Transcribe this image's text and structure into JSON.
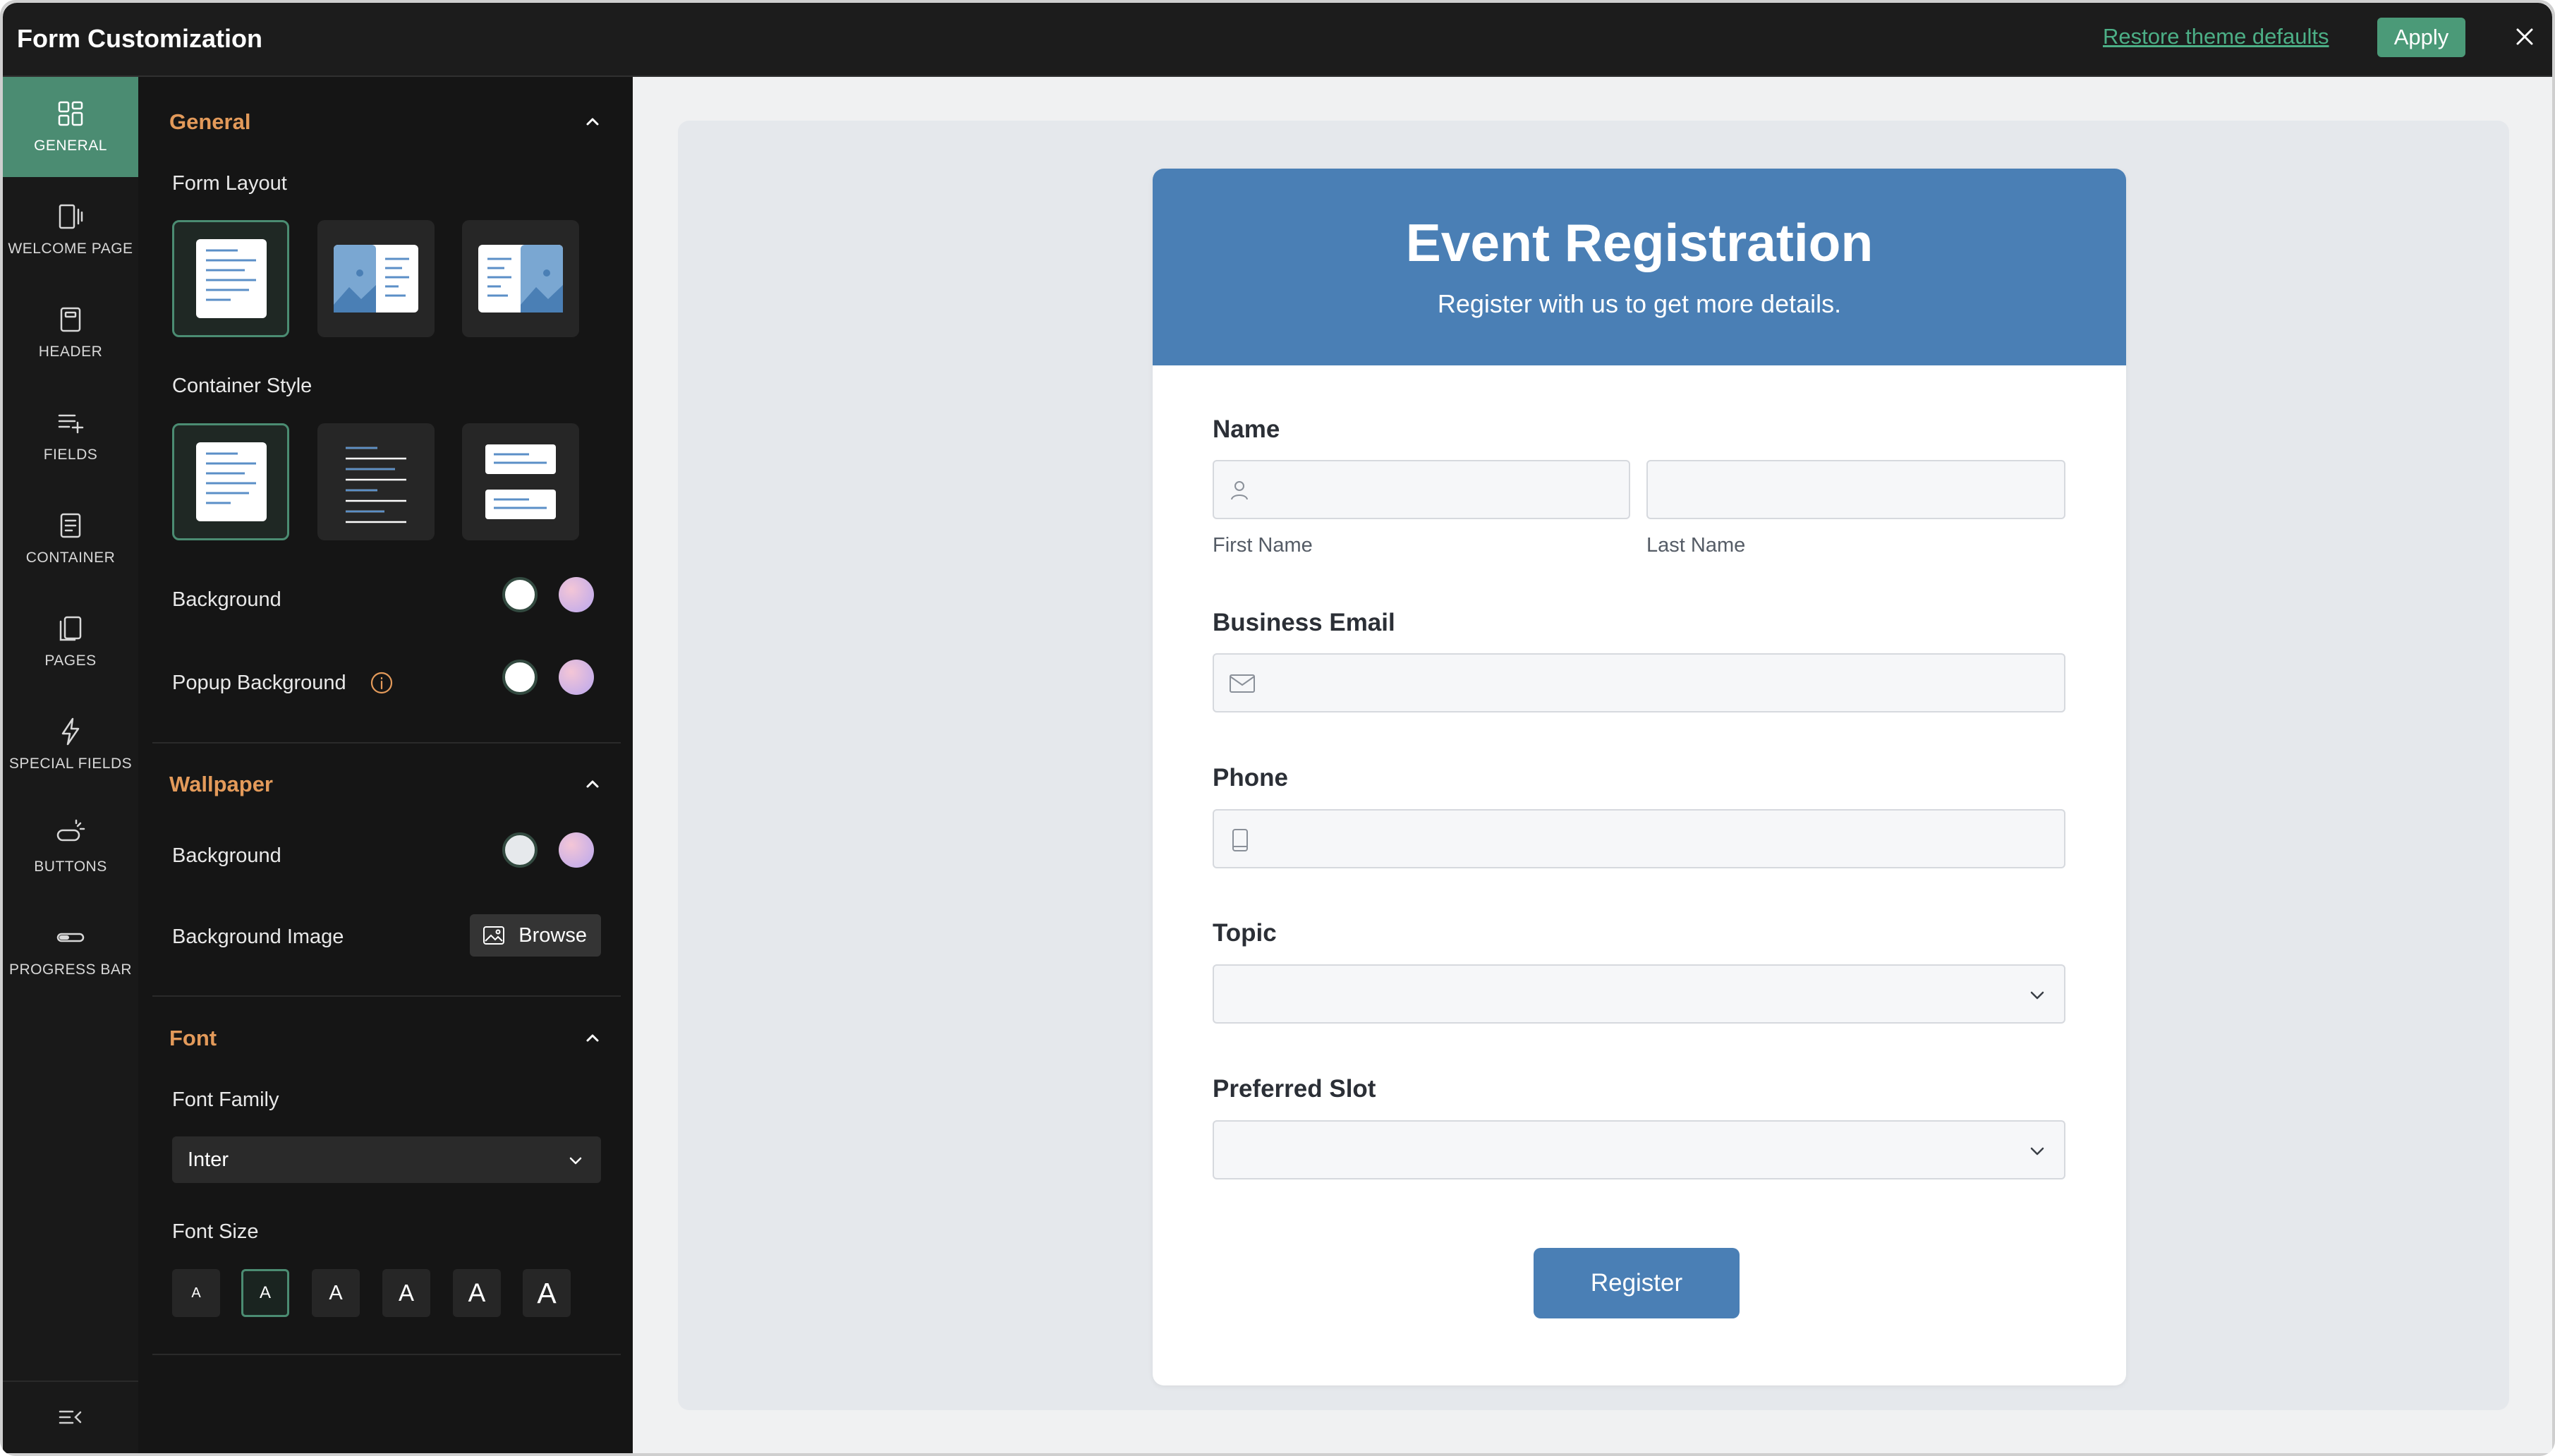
{
  "window": {
    "title": "Form Customization",
    "restore_label": "Restore theme defaults",
    "apply_label": "Apply",
    "close_icon": "close-icon"
  },
  "rail": {
    "items": [
      {
        "label": "GENERAL",
        "icon": "grid-icon",
        "active": true
      },
      {
        "label": "WELCOME PAGE",
        "icon": "welcome-page-icon",
        "active": false
      },
      {
        "label": "HEADER",
        "icon": "header-icon",
        "active": false
      },
      {
        "label": "FIELDS",
        "icon": "fields-icon",
        "active": false
      },
      {
        "label": "CONTAINER",
        "icon": "container-icon",
        "active": false
      },
      {
        "label": "PAGES",
        "icon": "pages-icon",
        "active": false
      },
      {
        "label": "SPECIAL FIELDS",
        "icon": "lightning-icon",
        "active": false
      },
      {
        "label": "BUTTONS",
        "icon": "button-click-icon",
        "active": false
      },
      {
        "label": "PROGRESS BAR",
        "icon": "progress-bar-icon",
        "active": false
      }
    ],
    "collapse_icon": "collapse-sidebar-icon"
  },
  "panel": {
    "general": {
      "title": "General",
      "form_layout_label": "Form Layout",
      "container_style_label": "Container Style",
      "background_label": "Background",
      "popup_background_label": "Popup Background"
    },
    "wallpaper": {
      "title": "Wallpaper",
      "background_label": "Background",
      "background_image_label": "Background Image",
      "browse_label": "Browse"
    },
    "font": {
      "title": "Font",
      "font_family_label": "Font Family",
      "font_family_value": "Inter",
      "font_size_label": "Font Size",
      "size_options": [
        "A",
        "A",
        "A",
        "A",
        "A",
        "A"
      ],
      "selected_size_index": 1
    },
    "colors": {
      "accent": "#4b8c72",
      "section_heading": "#e39a5a",
      "panel_bg": "#151515"
    }
  },
  "form": {
    "title": "Event Registration",
    "subtitle": "Register with us to get more details.",
    "header_color": "#4a7fb5",
    "name_label": "Name",
    "first_name_label": "First Name",
    "last_name_label": "Last Name",
    "email_label": "Business Email",
    "phone_label": "Phone",
    "topic_label": "Topic",
    "slot_label": "Preferred Slot",
    "register_label": "Register"
  }
}
